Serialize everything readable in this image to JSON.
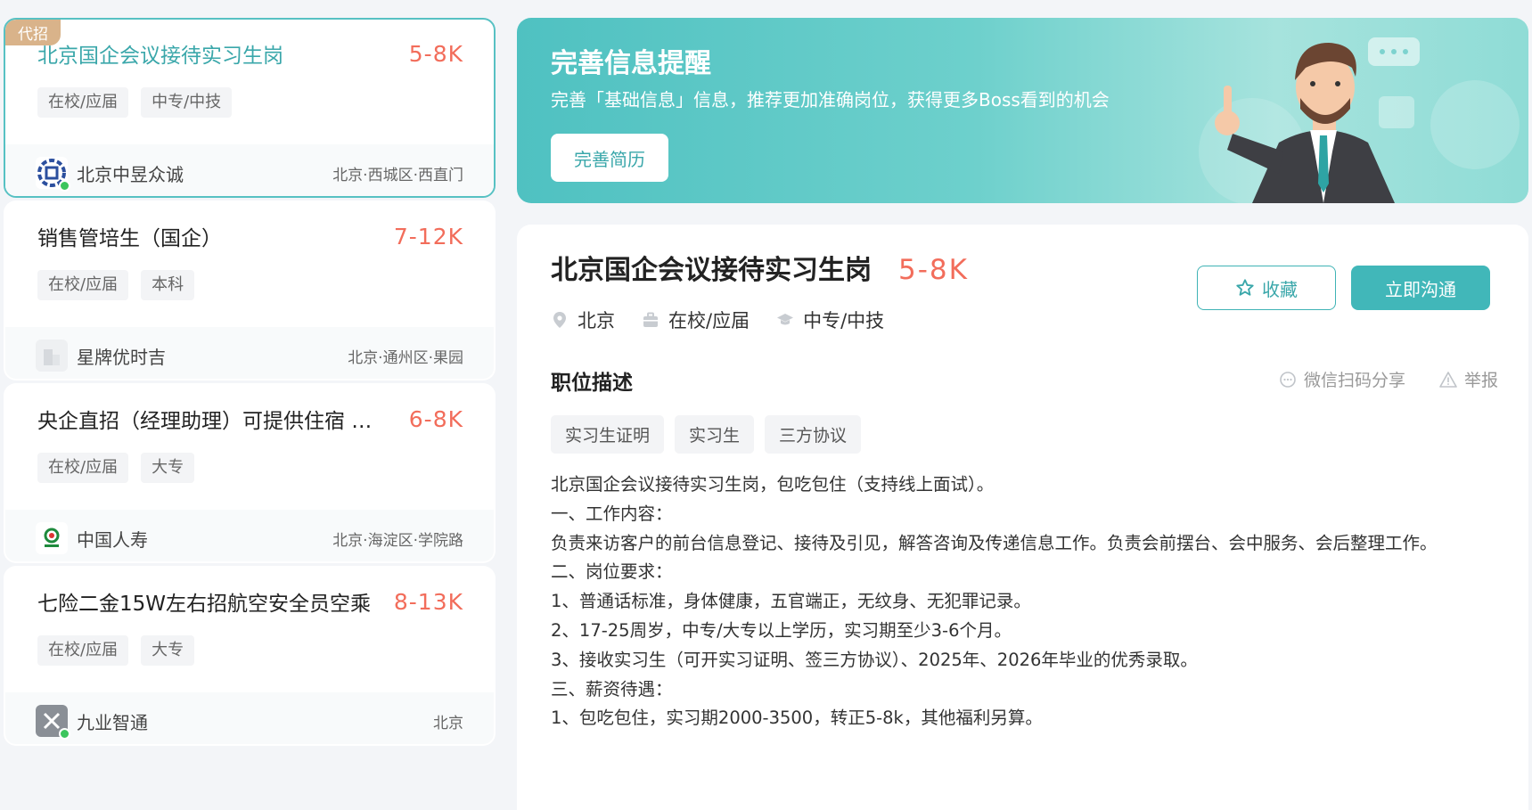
{
  "job_list": [
    {
      "title": "北京国企会议接待实习生岗",
      "salary": "5-8K",
      "tags": [
        "在校/应届",
        "中专/中技"
      ],
      "company": "北京中昱众诚",
      "location": "北京·西城区·西直门",
      "badge": "代招",
      "active": true,
      "online": true
    },
    {
      "title": "销售管培生（国企）",
      "salary": "7-12K",
      "tags": [
        "在校/应届",
        "本科"
      ],
      "company": "星牌优时吉",
      "location": "北京·通州区·果园",
      "online": false
    },
    {
      "title": "央企直招（经理助理）可提供住宿 …",
      "salary": "6-8K",
      "tags": [
        "在校/应届",
        "大专"
      ],
      "company": "中国人寿",
      "location": "北京·海淀区·学院路",
      "online": false
    },
    {
      "title": "七险二金15W左右招航空安全员空乘",
      "salary": "8-13K",
      "tags": [
        "在校/应届",
        "大专"
      ],
      "company": "九业智通",
      "location": "北京",
      "online": true
    }
  ],
  "banner": {
    "title": "完善信息提醒",
    "subtitle": "完善「基础信息」信息，推荐更加准确岗位，获得更多Boss看到的机会",
    "button": "完善简历"
  },
  "detail": {
    "title": "北京国企会议接待实习生岗",
    "salary": "5-8K",
    "city": "北京",
    "experience": "在校/应届",
    "degree": "中专/中技",
    "fav_label": "收藏",
    "chat_label": "立即沟通",
    "section_title": "职位描述",
    "share_label": "微信扫码分享",
    "report_label": "举报",
    "tags": [
      "实习生证明",
      "实习生",
      "三方协议"
    ],
    "description": [
      "北京国企会议接待实习生岗，包吃包住（支持线上面试）。",
      "一、工作内容：",
      "负责来访客户的前台信息登记、接待及引见，解答咨询及传递信息工作。负责会前摆台、会中服务、会后整理工作。",
      "二、岗位要求：",
      "1、普通话标准，身体健康，五官端正，无纹身、无犯罪记录。",
      "2、17-25周岁，中专/大专以上学历，实习期至少3-6个月。",
      "3、接收实习生（可开实习证明、签三方协议）、2025年、2026年毕业的优秀录取。",
      "三、薪资待遇：",
      "1、包吃包住，实习期2000-3500，转正5-8k，其他福利另算。"
    ]
  },
  "colors": {
    "accent": "#41b7b9",
    "salary": "#f26d5b",
    "badge": "#d9b38a"
  }
}
